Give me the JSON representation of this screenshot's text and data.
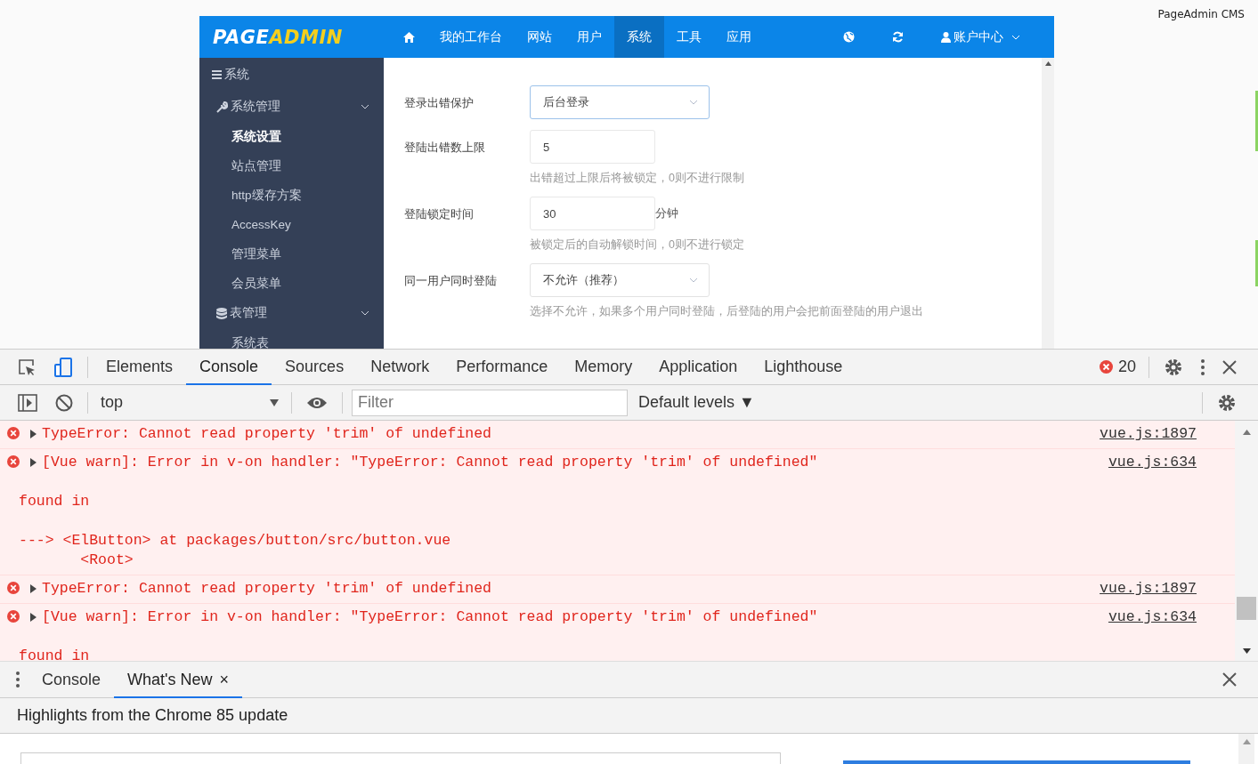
{
  "page": {
    "corner_label": "PageAdmin CMS"
  },
  "header": {
    "logo": [
      "PAGE",
      "ADMIN"
    ],
    "nav": [
      {
        "kind": "icon",
        "selected": false
      },
      {
        "kind": "text",
        "label": "我的工作台",
        "selected": false
      },
      {
        "kind": "text",
        "label": "网站",
        "selected": false
      },
      {
        "kind": "text",
        "label": "用户",
        "selected": false
      },
      {
        "kind": "text",
        "label": "系统",
        "selected": true
      },
      {
        "kind": "text",
        "label": "工具",
        "selected": false
      },
      {
        "kind": "text",
        "label": "应用",
        "selected": false
      }
    ],
    "account": "账户中心"
  },
  "sidebar": {
    "title": "系统",
    "groups": [
      {
        "label": "系统管理",
        "expanded": true,
        "children": [
          {
            "label": "系统设置",
            "selected": true
          },
          {
            "label": "站点管理",
            "selected": false
          },
          {
            "label": "http缓存方案",
            "selected": false
          },
          {
            "label": "AccessKey",
            "selected": false
          },
          {
            "label": "管理菜单",
            "selected": false
          },
          {
            "label": "会员菜单",
            "selected": false
          }
        ]
      },
      {
        "label": "表管理",
        "expanded": true,
        "children": [
          {
            "label": "系统表",
            "selected": false
          }
        ]
      }
    ]
  },
  "form": [
    {
      "label": "登录出错保护",
      "kind": "select",
      "value": "后台登录",
      "focused": true
    },
    {
      "label": "登陆出错数上限",
      "kind": "input",
      "value": "5",
      "hint": "出错超过上限后将被锁定，0则不进行限制"
    },
    {
      "label": "登陆锁定时间",
      "kind": "input",
      "value": "30",
      "suffix": "分钟",
      "hint": "被锁定后的自动解锁时间，0则不进行锁定"
    },
    {
      "label": "同一用户同时登陆",
      "kind": "select",
      "value": "不允许（推荐）",
      "focused": false,
      "hint": "选择不允许，如果多个用户同时登陆，后登陆的用户会把前面登陆的用户退出"
    }
  ],
  "devtools": {
    "tabs": [
      {
        "label": "Elements",
        "selected": false
      },
      {
        "label": "Console",
        "selected": true
      },
      {
        "label": "Sources",
        "selected": false
      },
      {
        "label": "Network",
        "selected": false
      },
      {
        "label": "Performance",
        "selected": false
      },
      {
        "label": "Memory",
        "selected": false
      },
      {
        "label": "Application",
        "selected": false
      },
      {
        "label": "Lighthouse",
        "selected": false
      }
    ],
    "error_count": "20",
    "context": "top",
    "filter_placeholder": "Filter",
    "levels": "Default levels ▼",
    "messages": [
      {
        "text": "TypeError: Cannot read property 'trim' of undefined",
        "source": "vue.js:1897"
      },
      {
        "text": "[Vue warn]: Error in v-on handler: \"TypeError: Cannot read property 'trim' of undefined\"",
        "source": "vue.js:634",
        "details": [
          "found in",
          "---> <ElButton> at packages/button/src/button.vue\n       <Root>"
        ]
      },
      {
        "text": "TypeError: Cannot read property 'trim' of undefined",
        "source": "vue.js:1897"
      },
      {
        "text": "[Vue warn]: Error in v-on handler: \"TypeError: Cannot read property 'trim' of undefined\"",
        "source": "vue.js:634",
        "details": [
          "found in"
        ]
      }
    ],
    "drawer_tabs": [
      {
        "label": "Console",
        "selected": false
      },
      {
        "label": "What's New",
        "selected": true,
        "close": "×"
      }
    ],
    "drawer_heading": "Highlights from the Chrome 85 update"
  }
}
